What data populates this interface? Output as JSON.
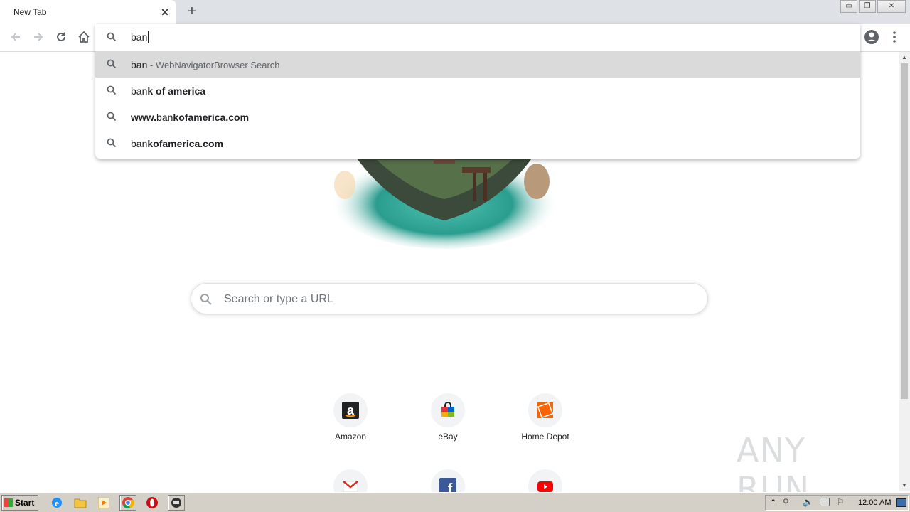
{
  "tab": {
    "title": "New Tab",
    "close_glyph": "✕",
    "new_tab_glyph": "+"
  },
  "window_controls": {
    "minimize": "▭",
    "restore": "❐",
    "close": "✕"
  },
  "toolbar": {
    "back": "arrow-left-icon",
    "forward": "arrow-right-icon",
    "reload": "reload-icon",
    "home": "home-icon",
    "profile": "profile-icon",
    "menu": "menu-icon"
  },
  "omnibox": {
    "text": "ban",
    "suggestions": [
      {
        "typed": "ban",
        "rest": "",
        "suffix": " - WebNavigatorBrowser Search",
        "selected": true
      },
      {
        "typed": "ban",
        "rest": "k of america",
        "suffix": "",
        "selected": false
      },
      {
        "prefix": "www.",
        "typed": "ban",
        "rest": "kofamerica.com",
        "suffix": "",
        "selected": false
      },
      {
        "typed": "ban",
        "rest": "kofamerica.com",
        "suffix": "",
        "selected": false
      }
    ]
  },
  "page": {
    "search_placeholder": "Search or type a URL",
    "tiles": [
      {
        "label": "Amazon",
        "icon": "amazon-icon"
      },
      {
        "label": "eBay",
        "icon": "ebay-icon"
      },
      {
        "label": "Home Depot",
        "icon": "home-depot-icon"
      },
      {
        "label": "",
        "icon": "gmail-icon"
      },
      {
        "label": "",
        "icon": "facebook-icon"
      },
      {
        "label": "",
        "icon": "youtube-icon"
      }
    ]
  },
  "watermark": "ANY RUN",
  "taskbar": {
    "start_label": "Start",
    "apps": [
      "internet-explorer-icon",
      "folder-icon",
      "media-player-icon",
      "chrome-icon",
      "opera-icon",
      "app-icon"
    ],
    "clock": "12:00 AM"
  },
  "colors": {
    "tabstrip": "#dee1e6",
    "selected_suggestion": "#dadada",
    "taskbar": "#d4d0c8"
  }
}
